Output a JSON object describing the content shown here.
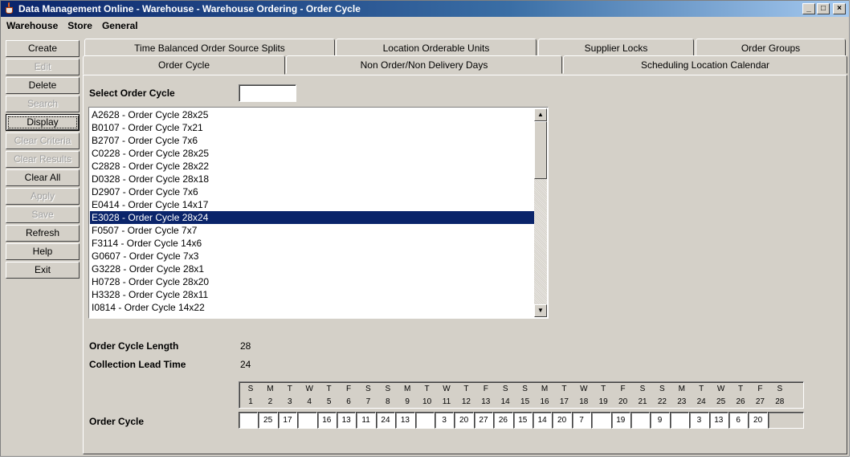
{
  "window": {
    "title": "Data Management Online - Warehouse - Warehouse Ordering - Order Cycle",
    "controls": [
      "_",
      "□",
      "×"
    ]
  },
  "menu": [
    "Warehouse",
    "Store",
    "General"
  ],
  "sidebar": [
    {
      "label": "Create",
      "enabled": true
    },
    {
      "label": "Edit",
      "enabled": false
    },
    {
      "label": "Delete",
      "enabled": true
    },
    {
      "label": "Search",
      "enabled": false
    },
    {
      "label": "Display",
      "enabled": true,
      "focused": true
    },
    {
      "label": "Clear Criteria",
      "enabled": false
    },
    {
      "label": "Clear Results",
      "enabled": false
    },
    {
      "label": "Clear All",
      "enabled": true
    },
    {
      "label": "Apply",
      "enabled": false
    },
    {
      "label": "Save",
      "enabled": false
    },
    {
      "label": "Refresh",
      "enabled": true
    },
    {
      "label": "Help",
      "enabled": true
    },
    {
      "label": "Exit",
      "enabled": true
    }
  ],
  "tabs_back": [
    "Time Balanced Order Source Splits",
    "Location Orderable Units",
    "Supplier Locks",
    "Order Groups"
  ],
  "tabs_front": [
    "Order Cycle",
    "Non Order/Non Delivery Days",
    "Scheduling Location Calendar"
  ],
  "active_tab": "Order Cycle",
  "select_label": "Select Order Cycle",
  "search_value": "",
  "order_cycles": [
    "A2628 - Order Cycle 28x25",
    "B0107 - Order Cycle 7x21",
    "B2707 - Order Cycle 7x6",
    "C0228 - Order Cycle 28x25",
    "C2828 - Order Cycle 28x22",
    "D0328 - Order Cycle 28x18",
    "D2907 - Order Cycle 7x6",
    "E0414 - Order Cycle 14x17",
    "E3028 - Order Cycle 28x24",
    "F0507 - Order Cycle 7x7",
    "F3114 - Order Cycle 14x6",
    "G0607 - Order Cycle 7x3",
    "G3228 - Order Cycle 28x1",
    "H0728 - Order Cycle 28x20",
    "H3328 - Order Cycle 28x11",
    "I0814 - Order Cycle 14x22"
  ],
  "selected_cycle": "E3028 - Order Cycle 28x24",
  "details": {
    "length_label": "Order Cycle Length",
    "length_value": "28",
    "lead_label": "Collection Lead Time",
    "lead_value": "24",
    "cycle_label": "Order Cycle"
  },
  "days": [
    {
      "l": "S",
      "n": "1"
    },
    {
      "l": "M",
      "n": "2"
    },
    {
      "l": "T",
      "n": "3"
    },
    {
      "l": "W",
      "n": "4"
    },
    {
      "l": "T",
      "n": "5"
    },
    {
      "l": "F",
      "n": "6"
    },
    {
      "l": "S",
      "n": "7"
    },
    {
      "l": "S",
      "n": "8"
    },
    {
      "l": "M",
      "n": "9"
    },
    {
      "l": "T",
      "n": "10"
    },
    {
      "l": "W",
      "n": "11"
    },
    {
      "l": "T",
      "n": "12"
    },
    {
      "l": "F",
      "n": "13"
    },
    {
      "l": "S",
      "n": "14"
    },
    {
      "l": "S",
      "n": "15"
    },
    {
      "l": "M",
      "n": "16"
    },
    {
      "l": "T",
      "n": "17"
    },
    {
      "l": "W",
      "n": "18"
    },
    {
      "l": "T",
      "n": "19"
    },
    {
      "l": "F",
      "n": "20"
    },
    {
      "l": "S",
      "n": "21"
    },
    {
      "l": "S",
      "n": "22"
    },
    {
      "l": "M",
      "n": "23"
    },
    {
      "l": "T",
      "n": "24"
    },
    {
      "l": "W",
      "n": "25"
    },
    {
      "l": "T",
      "n": "26"
    },
    {
      "l": "F",
      "n": "27"
    },
    {
      "l": "S",
      "n": "28"
    }
  ],
  "cycle_values": [
    "",
    "25",
    "17",
    "",
    "16",
    "13",
    "11",
    "24",
    "13",
    "",
    "3",
    "20",
    "27",
    "26",
    "15",
    "14",
    "20",
    "7",
    "",
    "19",
    "",
    "9",
    "",
    "3",
    "13",
    "6",
    "20",
    ""
  ]
}
